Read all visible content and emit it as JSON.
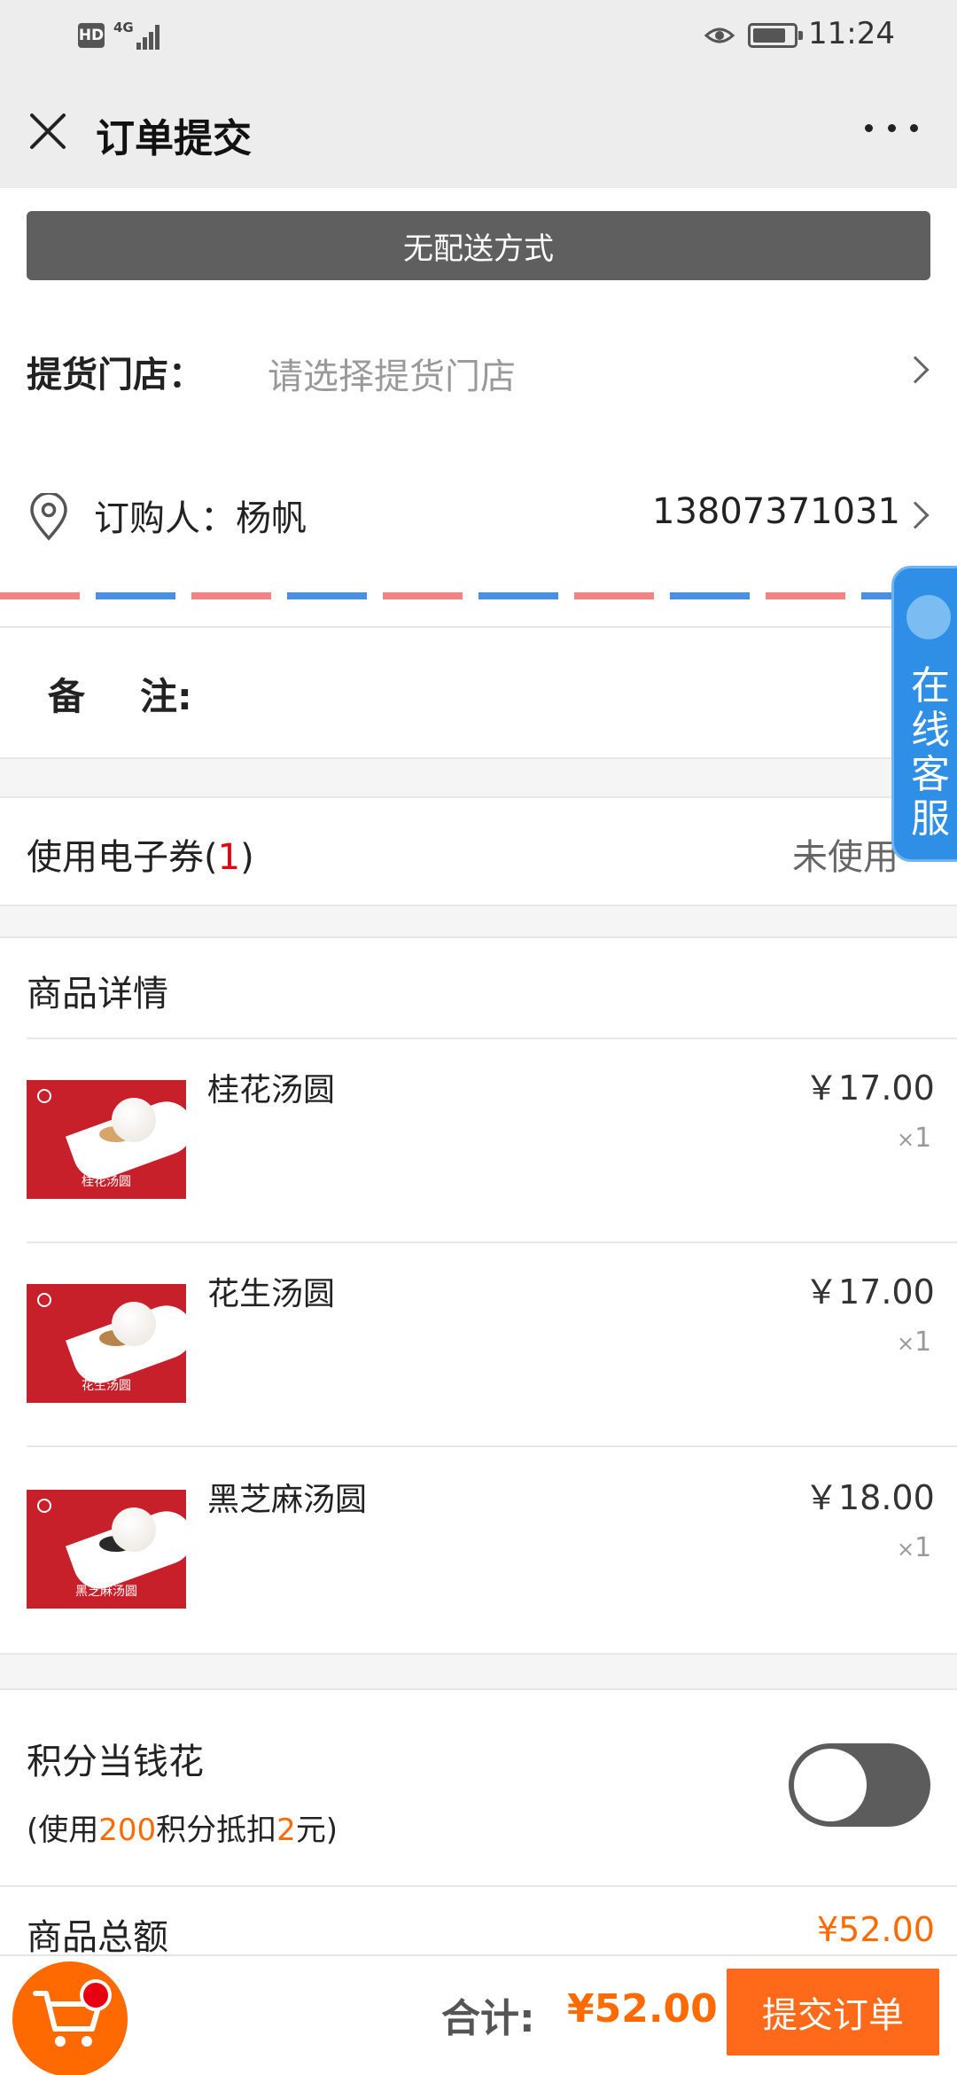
{
  "status_bar": {
    "hd": "HD",
    "network": "4G",
    "time": "11:24"
  },
  "nav": {
    "title": "订单提交"
  },
  "delivery": {
    "label": "无配送方式"
  },
  "pickup": {
    "label": "提货门店：",
    "placeholder": "请选择提货门店"
  },
  "buyer": {
    "label": "订购人：杨帆",
    "phone": "13807371031"
  },
  "remark": {
    "label_a": "备",
    "label_b": "注:"
  },
  "coupon": {
    "label_prefix": "使用电子券(",
    "count": "1",
    "label_suffix": ")",
    "status": "未使用"
  },
  "products": {
    "title": "商品详情",
    "items": [
      {
        "name": "桂花汤圆",
        "price": "￥17.00",
        "qty_prefix": "×",
        "qty": "1",
        "image_caption": "桂花汤圆",
        "filling_color": "#d7a46a"
      },
      {
        "name": "花生汤圆",
        "price": "￥17.00",
        "qty_prefix": "×",
        "qty": "1",
        "image_caption": "花生汤圆",
        "filling_color": "#b9844a"
      },
      {
        "name": "黑芝麻汤圆",
        "price": "￥18.00",
        "qty_prefix": "×",
        "qty": "1",
        "image_caption": "黑芝麻汤圆",
        "filling_color": "#2a2a2a"
      }
    ]
  },
  "points": {
    "title": "积分当钱花",
    "desc_a": "(使用",
    "points_value": "200",
    "desc_b": "积分抵扣",
    "amount": "2",
    "desc_c": "元)",
    "toggle_on": false
  },
  "summary": {
    "goods_total_label": "商品总额",
    "goods_total_value": "¥52.00"
  },
  "checkout": {
    "sum_label": "合计:",
    "sum_value": "¥52.00",
    "submit_label": "提交订单"
  },
  "service": {
    "label": "在线客服"
  },
  "colors": {
    "accent": "#ff6b00",
    "coupon_count": "#e60012",
    "service_blue": "#2f8ee5"
  }
}
